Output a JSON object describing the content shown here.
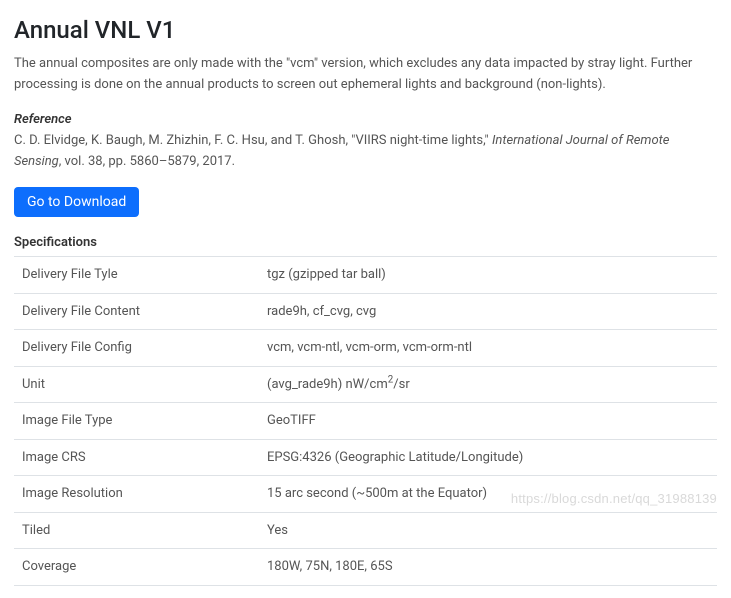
{
  "title": "Annual VNL V1",
  "description": "The annual composites are only made with the \"vcm\" version, which excludes any data impacted by stray light. Further processing is done on the annual products to screen out ephemeral lights and background (non-lights).",
  "reference": {
    "label": "Reference",
    "authors": "C. D. Elvidge, K. Baugh, M. Zhizhin, F. C. Hsu, and T. Ghosh,",
    "title_quoted": "\"VIIRS night-time lights,\"",
    "journal": "International Journal of Remote Sensing",
    "rest": ", vol. 38, pp. 5860–5879, 2017."
  },
  "download_button": "Go to Download",
  "specs_heading": "Specifications",
  "specs": [
    {
      "label": "Delivery File Tyle",
      "value": "tgz (gzipped tar ball)"
    },
    {
      "label": "Delivery File Content",
      "value": "rade9h, cf_cvg, cvg"
    },
    {
      "label": "Delivery File Config",
      "value": "vcm, vcm-ntl, vcm-orm, vcm-orm-ntl"
    },
    {
      "label": "Unit",
      "value_html": "(avg_rade9h) nW/cm<sup>2</sup>/sr"
    },
    {
      "label": "Image File Type",
      "value": "GeoTIFF"
    },
    {
      "label": "Image CRS",
      "value": "EPSG:4326 (Geographic Latitude/Longitude)"
    },
    {
      "label": "Image Resolution",
      "value": "15 arc second (~500m at the Equator)"
    },
    {
      "label": "Tiled",
      "value": "Yes"
    },
    {
      "label": "Coverage",
      "value": "180W, 75N, 180E, 65S"
    }
  ],
  "watermark": "https://blog.csdn.net/qq_31988139"
}
